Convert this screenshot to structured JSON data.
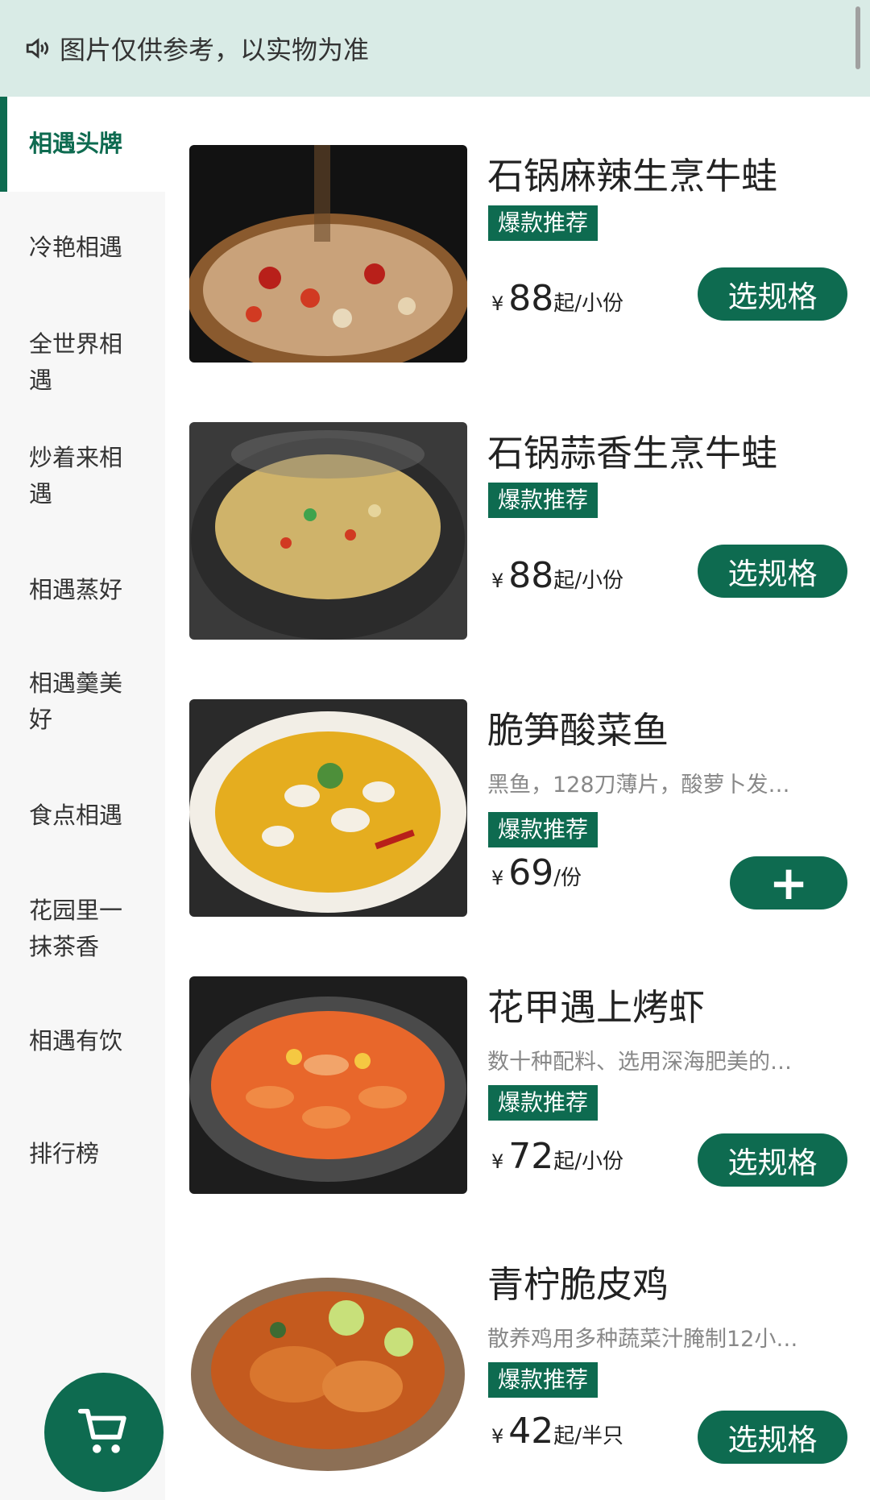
{
  "notice": {
    "text": "图片仅供参考，以实物为准",
    "icon": "speaker-icon"
  },
  "sidebar": {
    "categories": [
      {
        "label": "相遇头牌",
        "active": true
      },
      {
        "label": "冷艳相遇"
      },
      {
        "label": "全世界相遇"
      },
      {
        "label": "炒着来相遇"
      },
      {
        "label": "相遇蒸好"
      },
      {
        "label": "相遇羹美好"
      },
      {
        "label": "食点相遇"
      },
      {
        "label": "花园里一抹茶香"
      },
      {
        "label": "相遇有饮"
      },
      {
        "label": "排行榜"
      }
    ]
  },
  "products": [
    {
      "name": "石锅麻辣生烹牛蛙",
      "desc": "",
      "tag": "爆款推荐",
      "currency": "¥",
      "price": "88",
      "unit": "起/小份",
      "button": "选规格"
    },
    {
      "name": "石锅蒜香生烹牛蛙",
      "desc": "",
      "tag": "爆款推荐",
      "currency": "¥",
      "price": "88",
      "unit": "起/小份",
      "button": "选规格"
    },
    {
      "name": "脆笋酸菜鱼",
      "desc": "黑鱼，128刀薄片，酸萝卜发…",
      "tag": "爆款推荐",
      "currency": "¥",
      "price": "69",
      "unit": "/份",
      "button": "+"
    },
    {
      "name": "花甲遇上烤虾",
      "desc": "数十种配料、选用深海肥美的…",
      "tag": "爆款推荐",
      "currency": "¥",
      "price": "72",
      "unit": "起/小份",
      "button": "选规格"
    },
    {
      "name": "青柠脆皮鸡",
      "desc": "散养鸡用多种蔬菜汁腌制12小…",
      "tag": "爆款推荐",
      "currency": "¥",
      "price": "42",
      "unit": "起/半只",
      "button": "选规格"
    }
  ],
  "cart": {
    "icon": "cart-icon"
  },
  "colors": {
    "brand": "#0e6b50",
    "notice_bg": "#d9ebe6",
    "sidebar_bg": "#f7f7f7"
  }
}
